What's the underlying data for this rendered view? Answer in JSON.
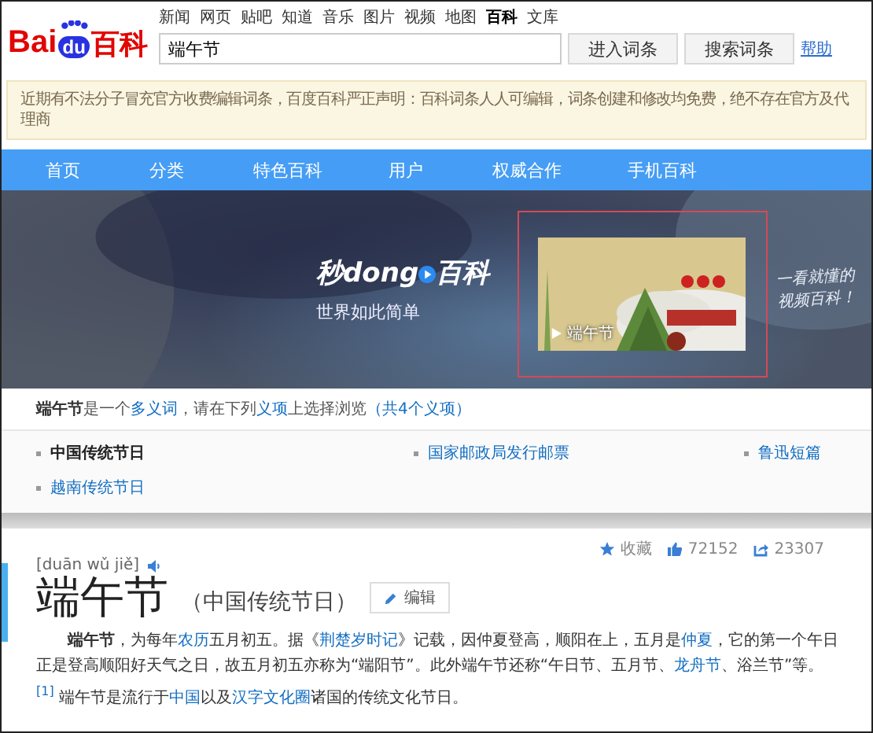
{
  "header": {
    "logo": {
      "latin_a": "Bai",
      "latin_b": "du",
      "cjk": "百科"
    },
    "top_links": [
      {
        "label": "新闻",
        "selected": false
      },
      {
        "label": "网页",
        "selected": false
      },
      {
        "label": "贴吧",
        "selected": false
      },
      {
        "label": "知道",
        "selected": false
      },
      {
        "label": "音乐",
        "selected": false
      },
      {
        "label": "图片",
        "selected": false
      },
      {
        "label": "视频",
        "selected": false
      },
      {
        "label": "地图",
        "selected": false
      },
      {
        "label": "百科",
        "selected": true
      },
      {
        "label": "文库",
        "selected": false
      }
    ],
    "search": {
      "value": "端午节"
    },
    "buttons": [
      "进入词条",
      "搜索词条"
    ],
    "help": "帮助"
  },
  "notice": "近期有不法分子冒充官方收费编辑词条，百度百科严正声明：百科词条人人可编辑，词条创建和修改均免费，绝不存在官方及代理商",
  "nav": [
    {
      "label": "首页"
    },
    {
      "label": "分类"
    },
    {
      "label": "特色百科"
    },
    {
      "label": "用户"
    },
    {
      "label": "权威合作"
    },
    {
      "label": "手机百科"
    }
  ],
  "banner": {
    "logo_a": "秒dong",
    "logo_b": "百科",
    "slogan": "世界如此简单",
    "video_caption": "端午节",
    "note": "一看就懂的视频百科！"
  },
  "disambiguation": {
    "line": [
      {
        "kind": "bold",
        "text": "端午节"
      },
      {
        "kind": "text",
        "text": "是一个"
      },
      {
        "kind": "link",
        "text": "多义词"
      },
      {
        "kind": "text",
        "text": "，请在下列"
      },
      {
        "kind": "link",
        "text": "义项"
      },
      {
        "kind": "text",
        "text": "上选择浏览"
      },
      {
        "kind": "link",
        "text": "（共4个义项）"
      }
    ],
    "items": [
      {
        "label": "中国传统节日",
        "selected": true
      },
      {
        "label": "国家邮政局发行邮票",
        "selected": false
      },
      {
        "label": "鲁迅短篇",
        "selected": false
      },
      {
        "label": "越南传统节日",
        "selected": false
      }
    ]
  },
  "article": {
    "pinyin": "[duān wǔ jiě]",
    "title": "端午节",
    "subtitle": "（中国传统节日）",
    "edit": "编辑",
    "stats": [
      {
        "kind": "star",
        "text": "收藏"
      },
      {
        "kind": "like",
        "text": "72152"
      },
      {
        "kind": "share",
        "text": "23307"
      }
    ],
    "paragraph": [
      {
        "kind": "bold",
        "text": "端午节"
      },
      {
        "kind": "text",
        "text": "，为每年"
      },
      {
        "kind": "link",
        "text": "农历"
      },
      {
        "kind": "text",
        "text": "五月初五。据《"
      },
      {
        "kind": "link",
        "text": "荆楚岁时记"
      },
      {
        "kind": "text",
        "text": "》记载，因仲夏登高，顺阳在上，五月是"
      },
      {
        "kind": "link",
        "text": "仲夏"
      },
      {
        "kind": "text",
        "text": "，它的第一个午日正是登高顺阳好天气之日，故五月初五亦称为“端阳节”。此外端午节还称“午日节、五月节、"
      },
      {
        "kind": "link",
        "text": "龙舟节"
      },
      {
        "kind": "text",
        "text": "、浴兰节”等。"
      },
      {
        "kind": "ref",
        "text": "[1]"
      },
      {
        "kind": "text",
        "text": " 端午节是流行于"
      },
      {
        "kind": "link",
        "text": "中国"
      },
      {
        "kind": "text",
        "text": "以及"
      },
      {
        "kind": "link",
        "text": "汉字文化圈"
      },
      {
        "kind": "text",
        "text": "诸国的传统文化节日。"
      }
    ]
  }
}
